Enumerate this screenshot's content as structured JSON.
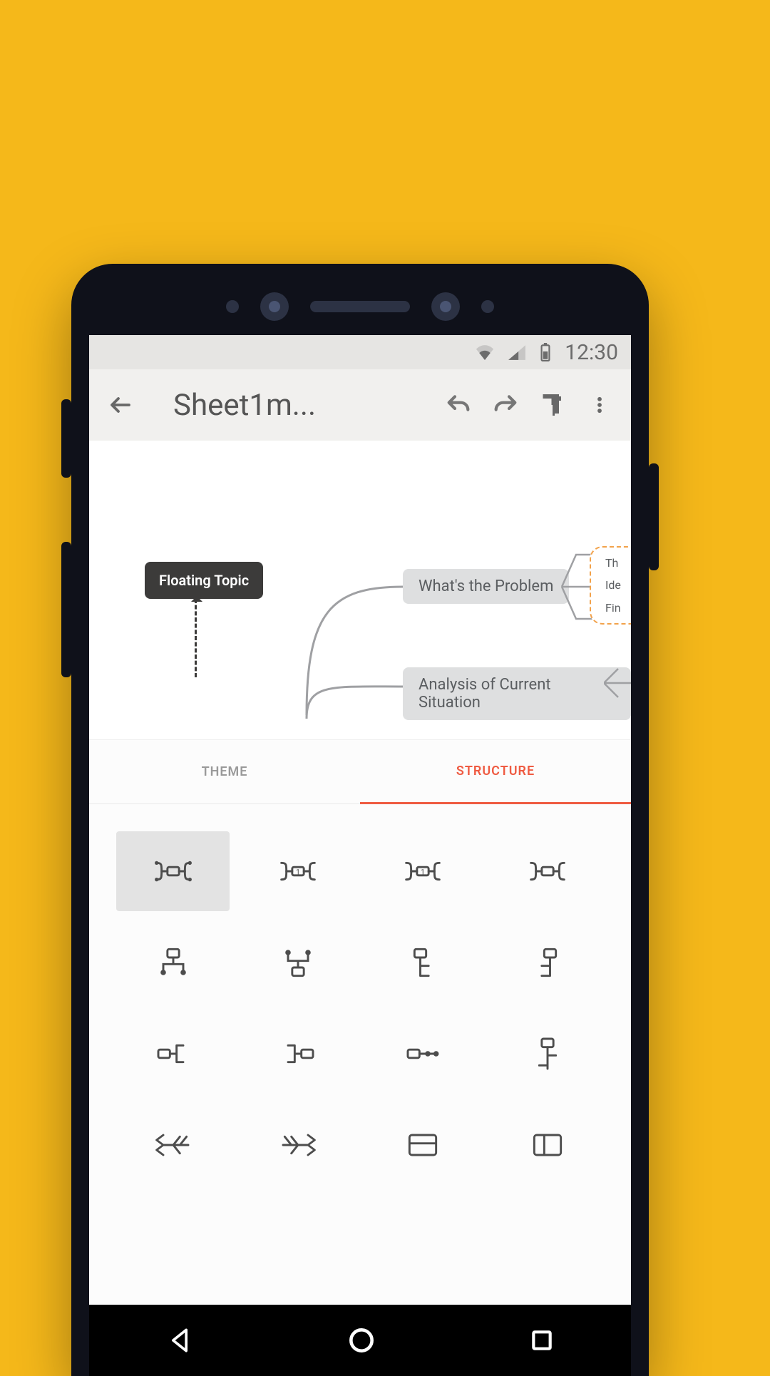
{
  "statusbar": {
    "time": "12:30"
  },
  "toolbar": {
    "title": "Sheet1m..."
  },
  "canvas": {
    "floating_label": "Floating Topic",
    "node1": "What's the Problem",
    "node2": "Analysis of Current Situation",
    "sub1": "Th",
    "sub2": "Ide",
    "sub3": "Fin"
  },
  "tabs": {
    "theme": "THEME",
    "structure": "STRUCTURE"
  },
  "selected_structure_index": 0
}
